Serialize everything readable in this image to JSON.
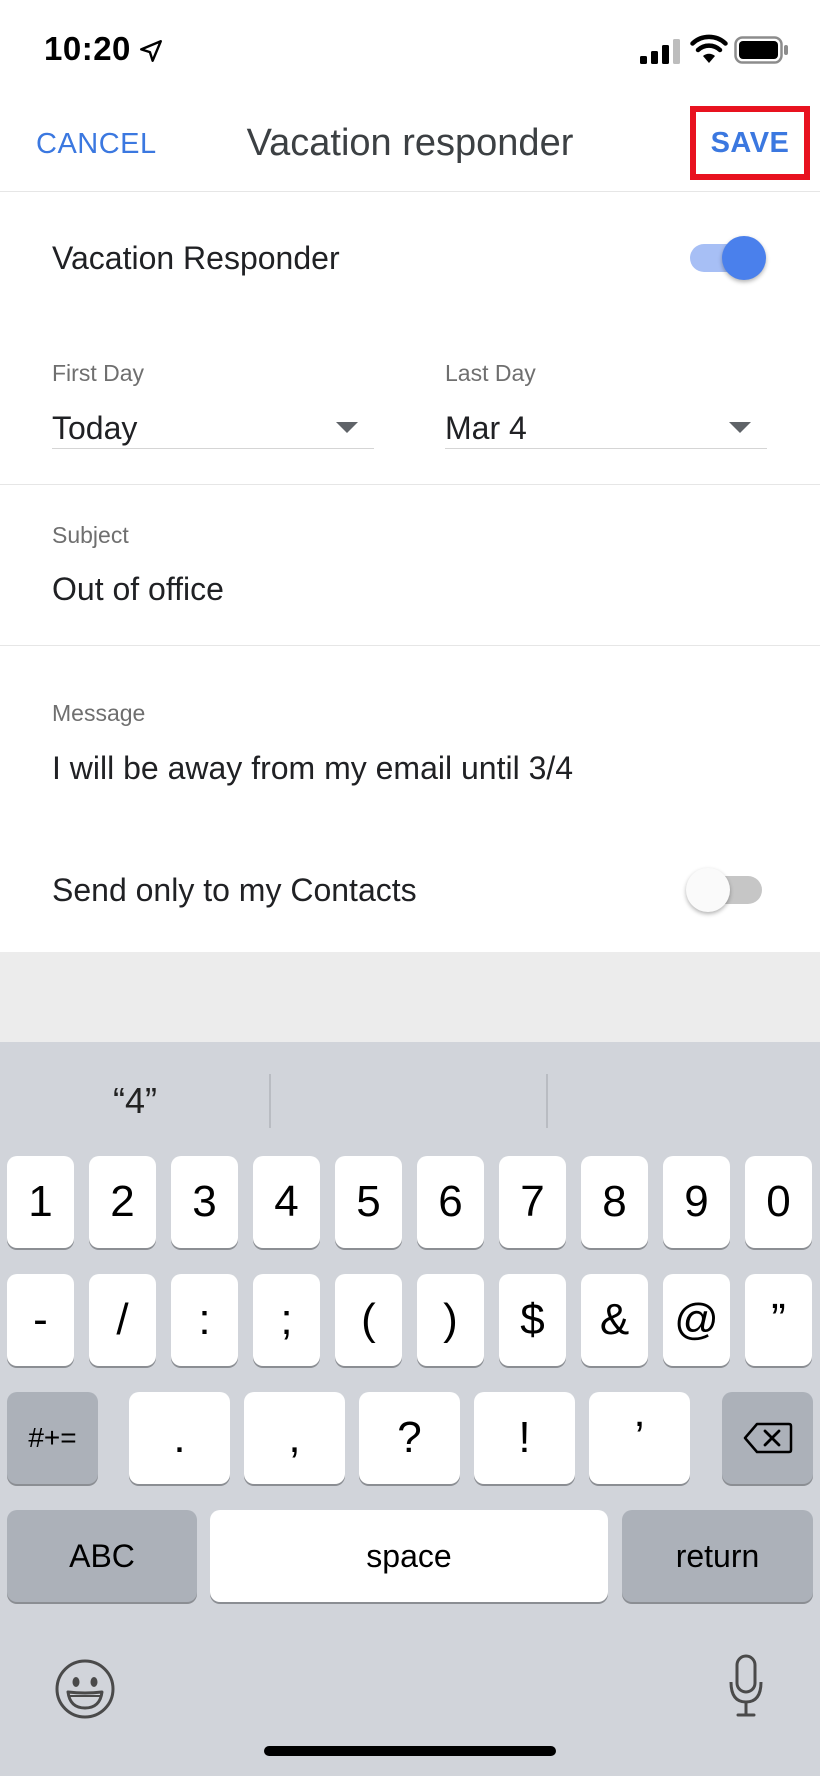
{
  "status_bar": {
    "time": "10:20"
  },
  "header": {
    "cancel_label": "CANCEL",
    "title": "Vacation responder",
    "save_label": "SAVE"
  },
  "form": {
    "vacation_responder": {
      "label": "Vacation Responder",
      "enabled": true
    },
    "first_day": {
      "label": "First Day",
      "value": "Today"
    },
    "last_day": {
      "label": "Last Day",
      "value": "Mar 4"
    },
    "subject": {
      "label": "Subject",
      "value": "Out of office"
    },
    "message": {
      "label": "Message",
      "value": "I will be away from my email until 3/4"
    },
    "send_only_contacts": {
      "label": "Send only to my Contacts",
      "enabled": false
    }
  },
  "keyboard": {
    "suggestions": [
      "“4”",
      "",
      ""
    ],
    "row1": [
      "1",
      "2",
      "3",
      "4",
      "5",
      "6",
      "7",
      "8",
      "9",
      "0"
    ],
    "row2": [
      "-",
      "/",
      ":",
      ";",
      "(",
      ")",
      "$",
      "&",
      "@",
      "”"
    ],
    "row3": [
      ".",
      ",",
      "?",
      "!",
      "’"
    ],
    "symbols_label": "#+=",
    "abc_label": "ABC",
    "space_label": "space",
    "return_label": "return",
    "icons": [
      "backspace-icon",
      "emoji-icon",
      "microphone-icon"
    ]
  },
  "colors": {
    "accent": "#3b78e0",
    "highlight": "#e8121f",
    "toggle_on": "#4a80ec"
  }
}
